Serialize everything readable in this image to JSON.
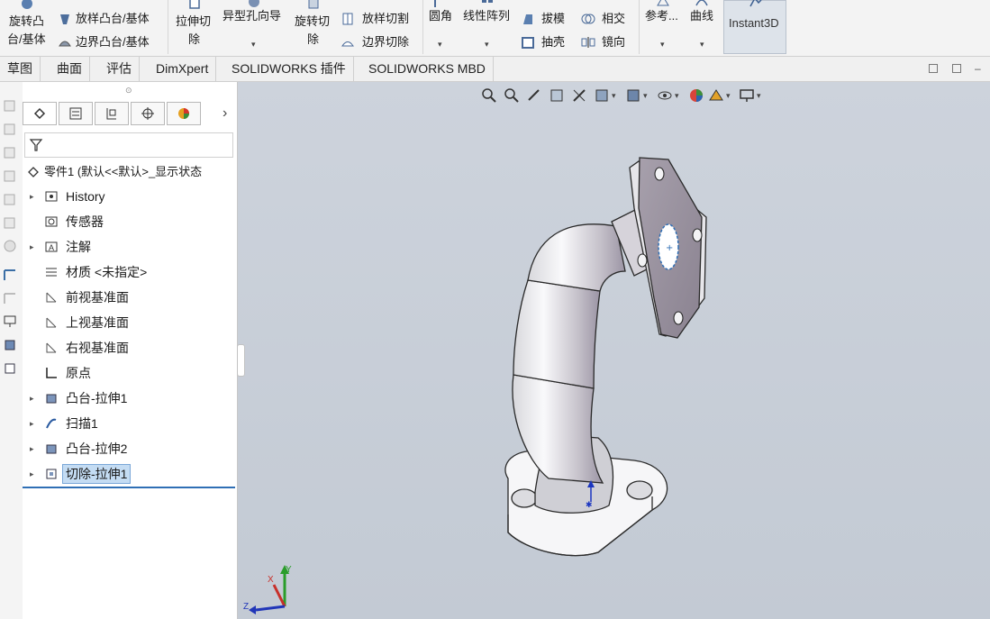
{
  "ribbon": {
    "revolve_boss_top": "旋转凸",
    "revolve_boss_bottom": "台/基体",
    "loft_boss": "放样凸台/基体",
    "boundary_boss": "边界凸台/基体",
    "extruded_cut_top": "拉伸切",
    "extruded_cut_bottom": "除",
    "hole_wizard": "异型孔向导",
    "revolved_cut_top": "旋转切",
    "revolved_cut_bottom": "除",
    "lofted_cut": "放样切割",
    "boundary_cut": "边界切除",
    "fillet": "圆角",
    "linear_pattern": "线性阵列",
    "draft": "拔模",
    "intersect": "相交",
    "shell": "抽壳",
    "mirror": "镜向",
    "reference": "参考...",
    "curves": "曲线",
    "instant3d": "Instant3D"
  },
  "tabs": [
    "草图",
    "曲面",
    "评估",
    "DimXpert",
    "SOLIDWORKS 插件",
    "SOLIDWORKS MBD"
  ],
  "feature_tree": {
    "root": "零件1 (默认<<默认>_显示状态",
    "items": [
      {
        "label": "History",
        "icon": "history-icon",
        "arrow": true
      },
      {
        "label": "传感器",
        "icon": "sensor-icon",
        "arrow": false
      },
      {
        "label": "注解",
        "icon": "annotation-icon",
        "arrow": true
      },
      {
        "label": "材质 <未指定>",
        "icon": "material-icon",
        "arrow": false
      },
      {
        "label": "前视基准面",
        "icon": "plane-icon",
        "arrow": false
      },
      {
        "label": "上视基准面",
        "icon": "plane-icon",
        "arrow": false
      },
      {
        "label": "右视基准面",
        "icon": "plane-icon",
        "arrow": false
      },
      {
        "label": "原点",
        "icon": "origin-icon",
        "arrow": false
      },
      {
        "label": "凸台-拉伸1",
        "icon": "boss-extrude-icon",
        "arrow": true
      },
      {
        "label": "扫描1",
        "icon": "sweep-icon",
        "arrow": true
      },
      {
        "label": "凸台-拉伸2",
        "icon": "boss-extrude-icon",
        "arrow": true
      },
      {
        "label": "切除-拉伸1",
        "icon": "cut-extrude-icon",
        "arrow": true,
        "selected": true
      }
    ]
  },
  "triad": {
    "x": "X",
    "y": "Y",
    "z": "Z"
  },
  "colors": {
    "accent": "#2f6fb5",
    "selection": "#c4dcf3",
    "viewport_bg": "#c9cfd8"
  }
}
